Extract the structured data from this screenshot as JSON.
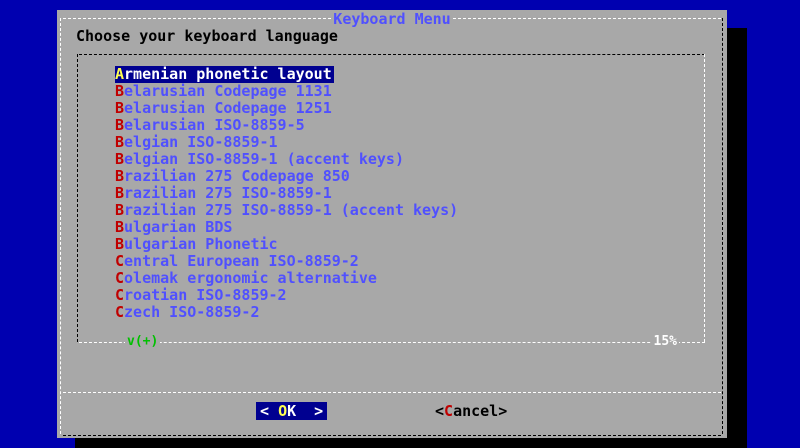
{
  "dialog": {
    "title": "Keyboard Menu",
    "prompt": "Choose your keyboard language",
    "scroll_indicator": "v(+)",
    "scroll_percent": "15%"
  },
  "list": {
    "selected_index": 0,
    "items": [
      {
        "hotkey": "A",
        "rest": "rmenian phonetic layout"
      },
      {
        "hotkey": "B",
        "rest": "elarusian Codepage 1131"
      },
      {
        "hotkey": "B",
        "rest": "elarusian Codepage 1251"
      },
      {
        "hotkey": "B",
        "rest": "elarusian ISO-8859-5"
      },
      {
        "hotkey": "B",
        "rest": "elgian ISO-8859-1"
      },
      {
        "hotkey": "B",
        "rest": "elgian ISO-8859-1 (accent keys)"
      },
      {
        "hotkey": "B",
        "rest": "razilian 275 Codepage 850"
      },
      {
        "hotkey": "B",
        "rest": "razilian 275 ISO-8859-1"
      },
      {
        "hotkey": "B",
        "rest": "razilian 275 ISO-8859-1 (accent keys)"
      },
      {
        "hotkey": "B",
        "rest": "ulgarian BDS"
      },
      {
        "hotkey": "B",
        "rest": "ulgarian Phonetic"
      },
      {
        "hotkey": "C",
        "rest": "entral European ISO-8859-2"
      },
      {
        "hotkey": "C",
        "rest": "olemak ergonomic alternative"
      },
      {
        "hotkey": "C",
        "rest": "roatian ISO-8859-2"
      },
      {
        "hotkey": "C",
        "rest": "zech ISO-8859-2"
      }
    ]
  },
  "buttons": {
    "ok": {
      "left": "< ",
      "hotkey": "O",
      "rest": "K",
      "right": "  >"
    },
    "cancel": {
      "left": "<",
      "hotkey": "C",
      "rest": "ancel",
      "right": ">"
    }
  },
  "colors": {
    "screen_bg": "#0000b0",
    "dialog_bg": "#a8a8a8",
    "item_text": "#5050ff",
    "hotkey": "#c00000",
    "selected_bg": "#000090",
    "selected_hotkey": "#ffff50"
  }
}
